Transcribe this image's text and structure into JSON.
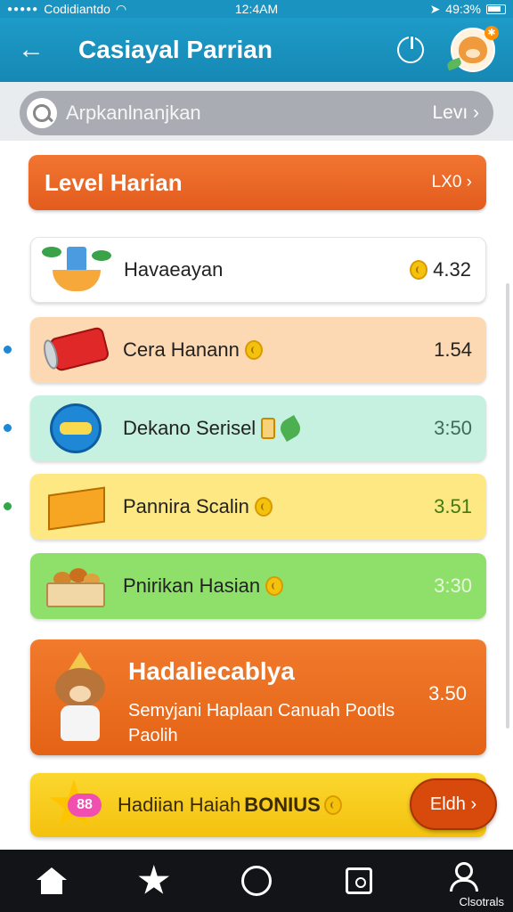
{
  "status_bar": {
    "carrier": "Codidiantdo",
    "time": "12:4AM",
    "battery": "49:3%"
  },
  "header": {
    "title": "Casiayal Parrian"
  },
  "search": {
    "placeholder": "Arpkanlnanjkan",
    "right_label": "Levı ›"
  },
  "level_banner": {
    "title": "Level Harian",
    "right_label": "LX0 ›"
  },
  "rows": [
    {
      "label": "Havaeayan",
      "value": "4.32"
    },
    {
      "label": "Cera Hanann",
      "value": "1.54"
    },
    {
      "label": "Dekano Serisel",
      "value": "3:50"
    },
    {
      "label": "Pannira Scalin",
      "value": "3.51"
    },
    {
      "label": "Pnirikan Hasian",
      "value": "3:30"
    }
  ],
  "promo": {
    "title": "Hadaliecablya",
    "subtitle": "Semyjani Haplaan Canuah Pootls Paolih",
    "value": "3.50"
  },
  "bonus": {
    "label": "Hadiian Haiah",
    "label_bold": "BONIUS",
    "badge": "88",
    "button": "Eldh ›"
  },
  "bottom_nav": {
    "caption": "Clsotrals"
  },
  "colors": {
    "header": "#1a93c1",
    "level_banner": "#e8662a",
    "row_2": "#fcd9b2",
    "row_3": "#c6f0e0",
    "row_4": "#fde883",
    "row_5": "#8ee06a",
    "promo": "#e46316",
    "bonus": "#f4c10f"
  },
  "icons": [
    "back-arrow-icon",
    "power-icon",
    "search-icon",
    "coin-icon",
    "home-icon",
    "star-icon",
    "circle-icon",
    "gift-icon",
    "profile-icon"
  ]
}
